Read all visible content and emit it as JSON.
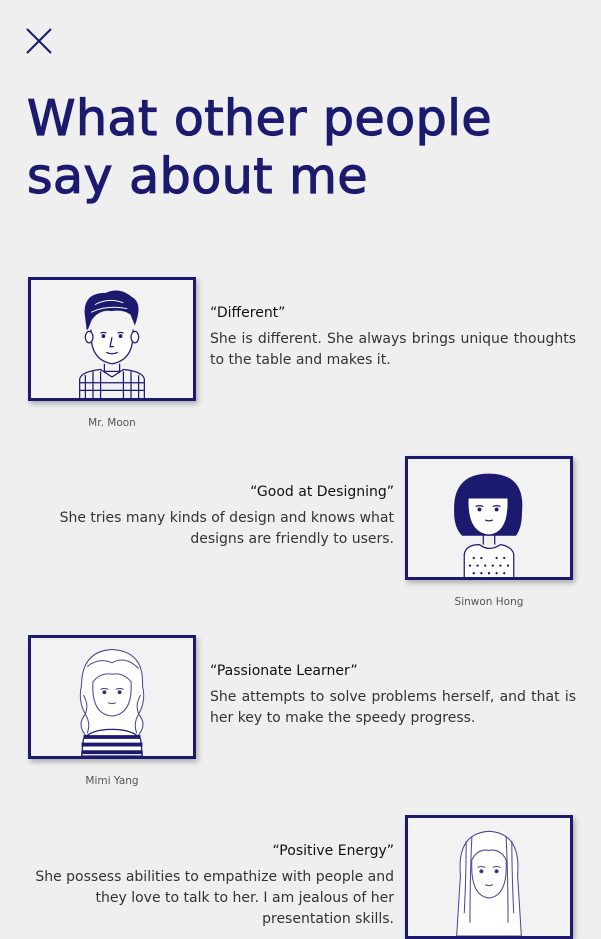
{
  "header": {
    "close_icon": "close-icon",
    "title": "What other people say about me"
  },
  "colors": {
    "accent": "#1b1a6e",
    "background": "#efefef"
  },
  "testimonials": [
    {
      "quote_title": "“Different”",
      "quote_text": "She is different. She always brings unique thoughts to the table and makes it.",
      "name": "Mr. Moon",
      "portrait": "man-illustration"
    },
    {
      "quote_title": "“Good at Designing”",
      "quote_text": "She tries many kinds of design and knows what designs are friendly to users.",
      "name": "Sinwon Hong",
      "portrait": "woman-bob-hair-illustration"
    },
    {
      "quote_title": "“Passionate Learner”",
      "quote_text": "She attempts to solve problems herself, and that is her key to make the speedy progress.",
      "name": "Mimi Yang",
      "portrait": "woman-wavy-hair-illustration"
    },
    {
      "quote_title": "“Positive Energy”",
      "quote_text": "She possess abilities to empathize with people and they love to talk to her. I am jealous of her presentation skills.",
      "name": "",
      "portrait": "woman-long-hair-illustration"
    }
  ]
}
